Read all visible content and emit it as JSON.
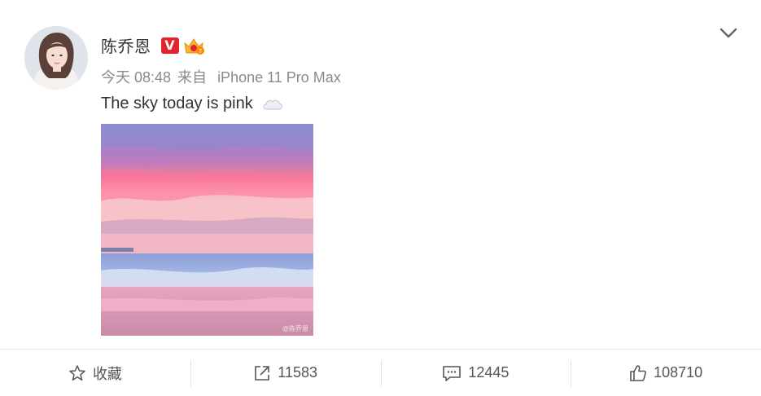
{
  "post": {
    "author_name": "陈乔恩",
    "vip_badge": "V",
    "timestamp": "今天 08:48",
    "source_prefix": "来自",
    "source_device": "iPhone 11 Pro Max",
    "text": "The sky today is pink",
    "image_watermark": "@陈乔恩"
  },
  "actions": {
    "favorite_label": "收藏",
    "repost_count": "11583",
    "comment_count": "12445",
    "like_count": "108710"
  },
  "colors": {
    "vip_red": "#e5232e",
    "text_primary": "#333333",
    "text_meta": "#8a8a8a"
  },
  "icons": [
    "chevron-down-icon",
    "cloud-emoji-icon",
    "star-icon",
    "share-icon",
    "comment-icon",
    "thumbs-up-icon",
    "level-crown-icon"
  ]
}
